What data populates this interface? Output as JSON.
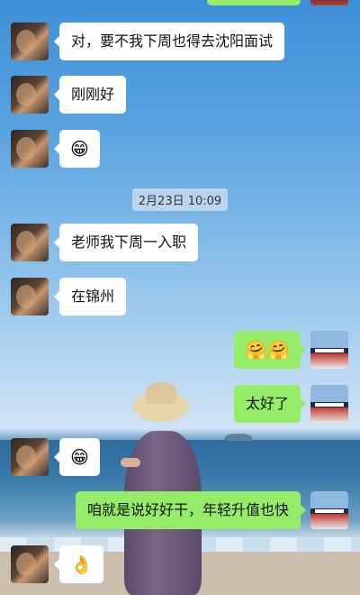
{
  "messages": [
    {
      "side": "left",
      "text": "对，要不我下周也得去沈阳面试"
    },
    {
      "side": "left",
      "text": "刚刚好"
    },
    {
      "side": "left",
      "text": "😁"
    },
    {
      "side": "left",
      "text": "老师我下周一入职"
    },
    {
      "side": "left",
      "text": "在锦州"
    },
    {
      "side": "right",
      "text": "🤗🤗"
    },
    {
      "side": "right",
      "text": "太好了"
    },
    {
      "side": "left",
      "text": "😁"
    },
    {
      "side": "right",
      "text": "咱就是说好好干，年轻升值也快"
    },
    {
      "side": "left",
      "text": "👌"
    }
  ],
  "timestamp": "2月23日 10:09"
}
